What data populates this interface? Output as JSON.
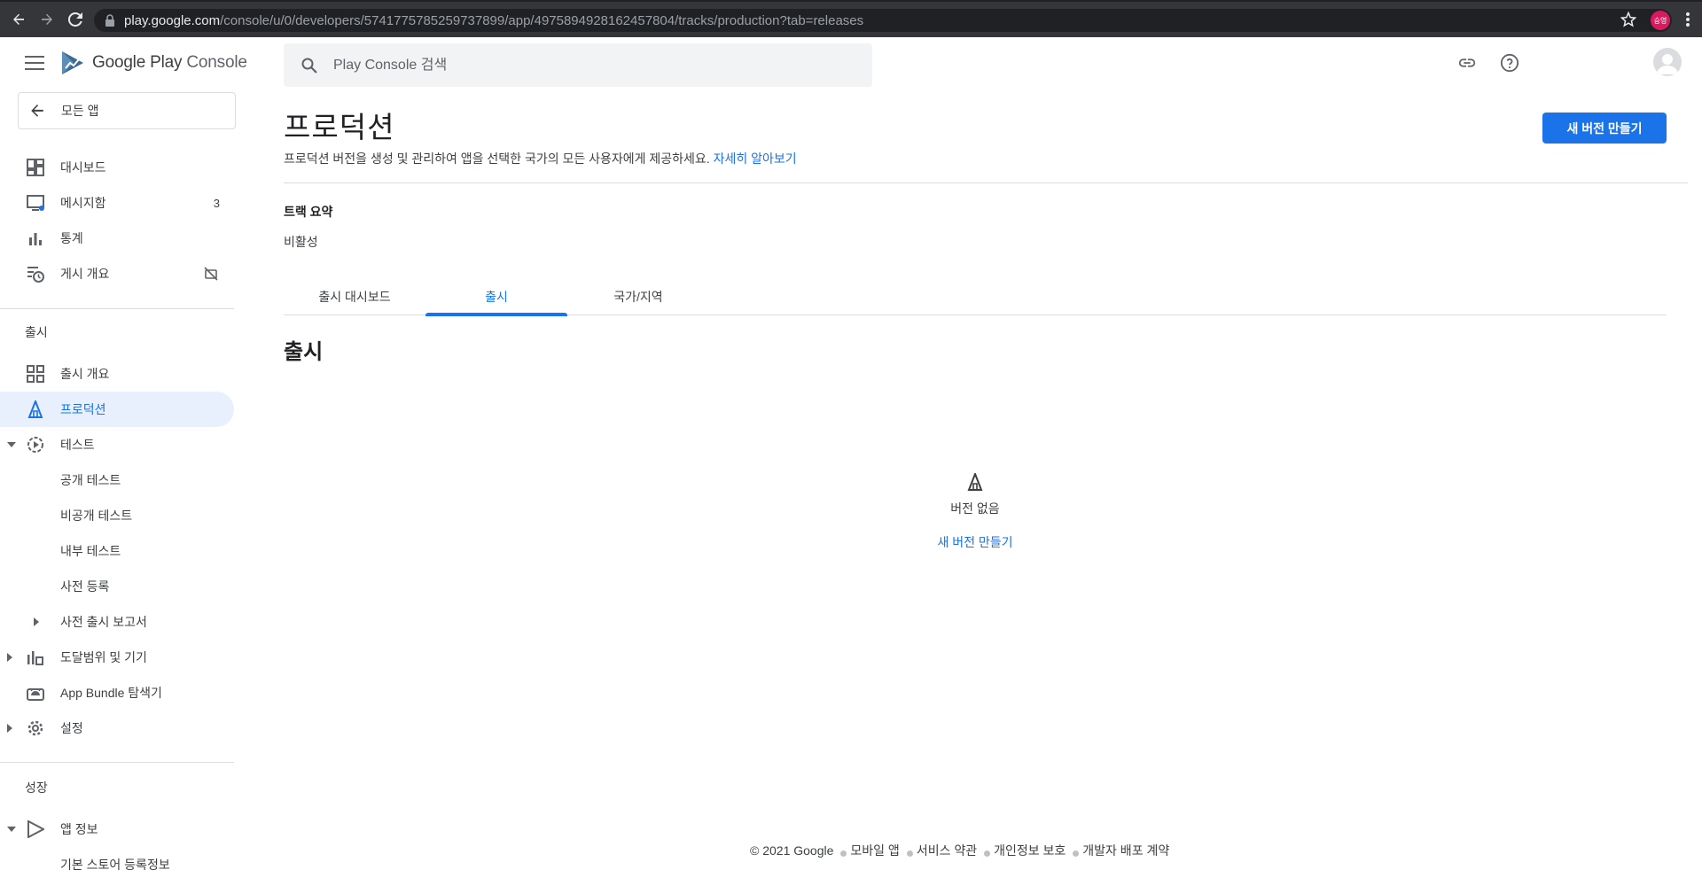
{
  "browser": {
    "url_host": "play.google.com",
    "url_path": "/console/u/0/developers/5741775785259737899/app/4975894928162457804/tracks/production?tab=releases",
    "profile_initials": "승영"
  },
  "header": {
    "logo_google_play": "Google Play",
    "logo_console": "Console",
    "search_placeholder": "Play Console 검색"
  },
  "sidebar": {
    "all_apps": "모든 앱",
    "top_items": [
      {
        "label": "대시보드",
        "icon": "dashboard-icon"
      },
      {
        "label": "메시지함",
        "icon": "inbox-icon",
        "count": "3"
      },
      {
        "label": "통계",
        "icon": "bar-chart-icon"
      },
      {
        "label": "게시 개요",
        "icon": "publishing-overview-icon"
      }
    ],
    "release_section": "출시",
    "release_items": [
      {
        "label": "출시 개요"
      },
      {
        "label": "프로덕션"
      },
      {
        "label": "테스트"
      },
      {
        "label": "공개 테스트"
      },
      {
        "label": "비공개 테스트"
      },
      {
        "label": "내부 테스트"
      },
      {
        "label": "사전 등록"
      },
      {
        "label": "사전 출시 보고서"
      },
      {
        "label": "도달범위 및 기기"
      },
      {
        "label": "App Bundle 탐색기"
      },
      {
        "label": "설정"
      }
    ],
    "growth_section": "성장",
    "growth_items": [
      {
        "label": "앱 정보"
      },
      {
        "label": "기본 스토어 등록정보"
      }
    ]
  },
  "main": {
    "title": "프로덕션",
    "description": "프로덕션 버전을 생성 및 관리하여 앱을 선택한 국가의 모든 사용자에게 제공하세요.",
    "learn_more": "자세히 알아보기",
    "create_button": "새 버전 만들기",
    "summary_title": "트랙 요약",
    "summary_status": "비활성",
    "tabs": [
      {
        "label": "출시 대시보드"
      },
      {
        "label": "출시"
      },
      {
        "label": "국가/지역"
      }
    ],
    "section_title": "출시",
    "empty_text": "버전 없음",
    "empty_link": "새 버전 만들기"
  },
  "footer": {
    "copyright": "© 2021 Google",
    "links": [
      "모바일 앱",
      "서비스 약관",
      "개인정보 보호",
      "개발자 배포 계약"
    ]
  },
  "colors": {
    "accent": "#1a73e8",
    "active_bg": "#e8f0fe",
    "browser_bg": "#35363a"
  }
}
